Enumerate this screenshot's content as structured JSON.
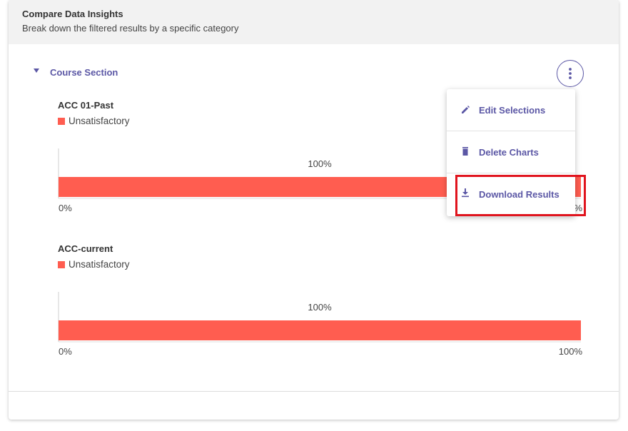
{
  "header": {
    "title": "Compare Data Insights",
    "subtitle": "Break down the filtered results by a specific category"
  },
  "section": {
    "title": "Course Section",
    "toggle_icon": "triangle-down-icon",
    "more_icon": "kebab-vertical-icon"
  },
  "colors": {
    "accent": "#5b57a5",
    "bar": "#ff5d50",
    "highlight": "#e0141e"
  },
  "menu": {
    "items": [
      {
        "label": "Edit Selections",
        "icon": "pencil-icon"
      },
      {
        "label": "Delete Charts",
        "icon": "trash-icon"
      },
      {
        "label": "Download Results",
        "icon": "download-icon"
      }
    ],
    "highlighted_index": 2
  },
  "chart_data": [
    {
      "type": "bar",
      "orientation": "horizontal",
      "stacked": true,
      "title": "ACC 01-Past",
      "series": [
        {
          "name": "Unsatisfactory",
          "values": [
            100
          ]
        }
      ],
      "data_labels": [
        "100%"
      ],
      "xlim": [
        0,
        100
      ],
      "x_ticks": [
        "0%",
        "100%"
      ],
      "legend": "top-left"
    },
    {
      "type": "bar",
      "orientation": "horizontal",
      "stacked": true,
      "title": "ACC-current",
      "series": [
        {
          "name": "Unsatisfactory",
          "values": [
            100
          ]
        }
      ],
      "data_labels": [
        "100%"
      ],
      "xlim": [
        0,
        100
      ],
      "x_ticks": [
        "0%",
        "100%"
      ],
      "legend": "top-left"
    }
  ]
}
